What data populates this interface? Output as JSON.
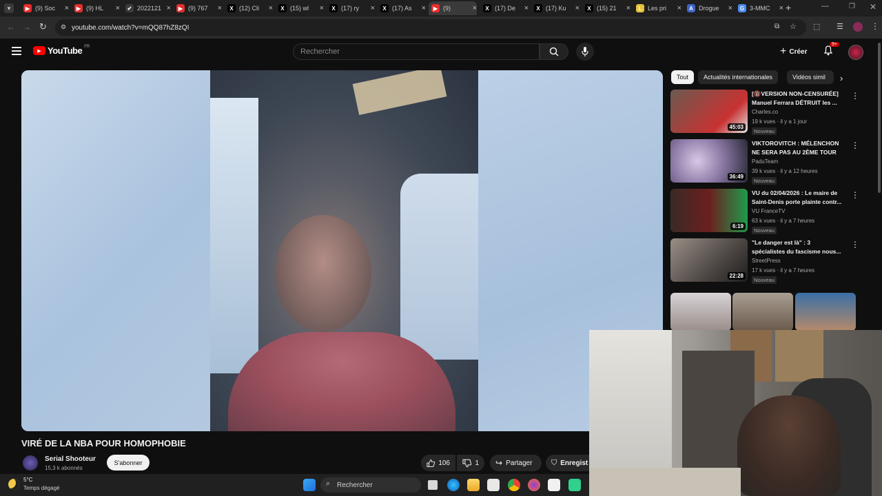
{
  "browser": {
    "tabs": [
      {
        "label": "(9) Soc",
        "color": "#e52e2e",
        "glyph": "▶"
      },
      {
        "label": "(9) HL",
        "color": "#e52e2e",
        "glyph": "▶"
      },
      {
        "label": "2022121",
        "color": "#3b3b3b",
        "glyph": "✔"
      },
      {
        "label": "(9) 767",
        "color": "#e52e2e",
        "glyph": "▶"
      },
      {
        "label": "(12) Cli",
        "color": "#000000",
        "glyph": "X"
      },
      {
        "label": "(15) wl",
        "color": "#000000",
        "glyph": "X"
      },
      {
        "label": "(17) ry",
        "color": "#000000",
        "glyph": "X"
      },
      {
        "label": "(17) As",
        "color": "#000000",
        "glyph": "X"
      },
      {
        "label": "(9)",
        "color": "#e52e2e",
        "glyph": "▶"
      },
      {
        "label": "(17) De",
        "color": "#000000",
        "glyph": "X"
      },
      {
        "label": "(17) Ku",
        "color": "#000000",
        "glyph": "X"
      },
      {
        "label": "(15) 21",
        "color": "#000000",
        "glyph": "X"
      },
      {
        "label": "Les pri",
        "color": "#e7c33a",
        "glyph": "L"
      },
      {
        "label": "Drogue",
        "color": "#3e64c8",
        "glyph": "A"
      },
      {
        "label": "3-MMC",
        "color": "#4a8cf0",
        "glyph": "G"
      }
    ],
    "url": "youtube.com/watch?v=mQQ87hZ8zQI"
  },
  "youtube": {
    "logo_text": "YouTube",
    "region": "FR",
    "search_placeholder": "Rechercher",
    "create_label": "Créer",
    "notif_badge": "9+"
  },
  "video": {
    "title": "VIRÉ DE LA NBA POUR HOMOPHOBIE",
    "channel": "Serial Shooteur",
    "subscribers": "15,3 k abonnés",
    "subscribe_label": "S'abonner",
    "likes": "106",
    "dislikes": "1",
    "share_label": "Partager",
    "save_label": "Enregist"
  },
  "chips": [
    "Tout",
    "Actualités internationales",
    "Vidéos simil"
  ],
  "recommendations": [
    {
      "title": "[🔞VERSION NON-CENSURÉE] Manuel Ferrara DÉTRUIT les ...",
      "channel": "Charles.co",
      "meta": "19 k vues · il y a 1 jour",
      "badge": "Nouveau",
      "duration": "45:03",
      "bg": "linear-gradient(135deg,#6b5a50,#c83232 70%,#e3e3e3)"
    },
    {
      "title": "VIKTOROVITCH : MÉLENCHON NE SERA PAS AU 2ÈME TOUR !?",
      "channel": "PaduTeam",
      "meta": "39 k vues · il y a 12 heures",
      "badge": "Nouveau",
      "duration": "36:49",
      "bg": "radial-gradient(circle at 35% 50%,#d8c8e4,#8f7ba8 45%,#2a2a3a)"
    },
    {
      "title": "VU du 02/04/2026 : Le maire de Saint-Denis porte plainte contr...",
      "channel": "VU FranceTV",
      "meta": "63 k vues · il y a 7 heures",
      "badge": "Nouveau",
      "duration": "6:19",
      "bg": "linear-gradient(90deg,#3a2a26,#6b1f1f 50%,#1f9b4b)"
    },
    {
      "title": "\"Le danger est là\" : 3 spécialistes du fascisme nous...",
      "channel": "StreetPress",
      "meta": "17 k vues · il y a 7 heures",
      "badge": "Nouveau",
      "duration": "22:28",
      "bg": "linear-gradient(135deg,#9a8f87,#4d4744 60%,#1e1e1e)"
    }
  ],
  "taskbar": {
    "temperature": "5°C",
    "weather": "Temps dégagé",
    "search_label": "Rechercher"
  }
}
